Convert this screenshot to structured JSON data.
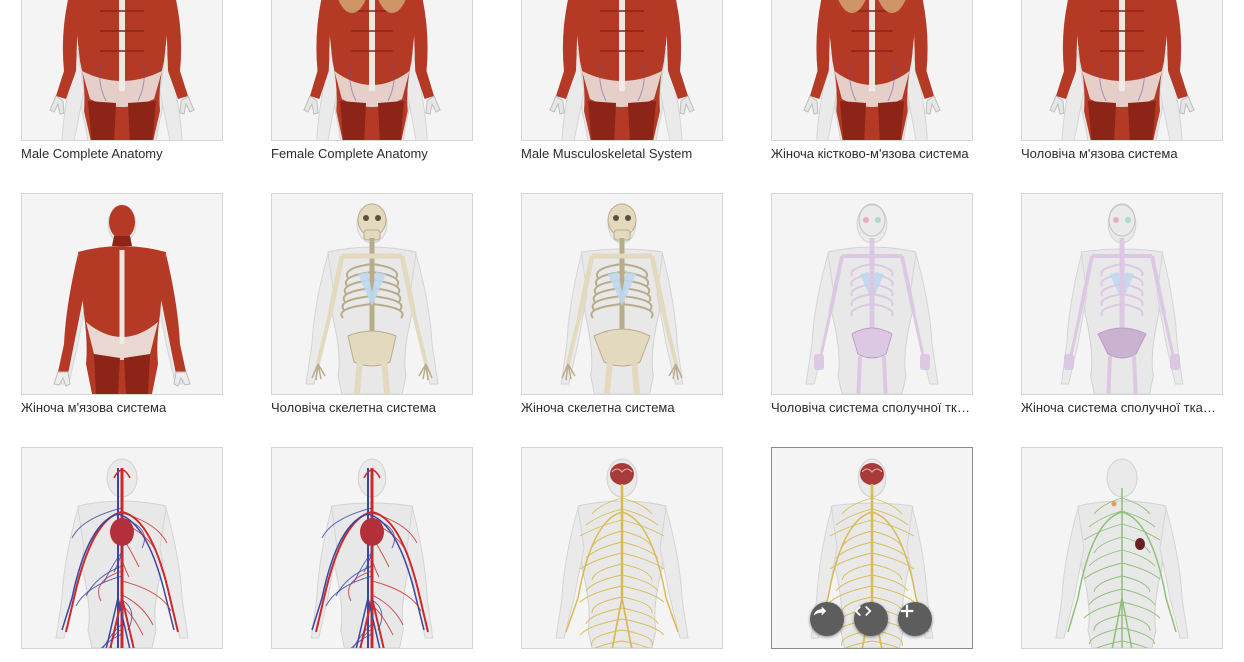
{
  "gallery": {
    "items": [
      {
        "name": "model-male-complete-anatomy",
        "title": "Male Complete Anatomy",
        "sex": "male",
        "system": "muscle",
        "view": "torso"
      },
      {
        "name": "model-female-complete-anatomy",
        "title": "Female Complete Anatomy",
        "sex": "female",
        "system": "muscle",
        "view": "torso"
      },
      {
        "name": "model-male-musculoskeletal",
        "title": "Male Musculoskeletal System",
        "sex": "male",
        "system": "muscle",
        "view": "torso"
      },
      {
        "name": "model-female-musculoskeletal",
        "title": "Жіноча кістково-м'язова система",
        "sex": "female",
        "system": "muscle",
        "view": "torso"
      },
      {
        "name": "model-male-muscular",
        "title": "Чоловіча м'язова система",
        "sex": "male",
        "system": "muscle",
        "view": "torso"
      },
      {
        "name": "model-female-muscular",
        "title": "Жіноча м'язова система",
        "sex": "female",
        "system": "muscle",
        "view": "full"
      },
      {
        "name": "model-male-skeletal",
        "title": "Чоловіча скелетна система",
        "sex": "male",
        "system": "skeleton",
        "view": "full"
      },
      {
        "name": "model-female-skeletal",
        "title": "Жіноча скелетна система",
        "sex": "female",
        "system": "skeleton",
        "view": "full"
      },
      {
        "name": "model-male-connective",
        "title": "Чоловіча система сполучної тканини",
        "sex": "male",
        "system": "connective",
        "view": "full"
      },
      {
        "name": "model-female-connective",
        "title": "Жіноча система сполучної тканини",
        "sex": "female",
        "system": "connective",
        "view": "full"
      },
      {
        "name": "model-male-cardiovascular",
        "title": "",
        "sex": "male",
        "system": "vascular",
        "view": "full"
      },
      {
        "name": "model-female-cardiovascular",
        "title": "",
        "sex": "female",
        "system": "vascular",
        "view": "full"
      },
      {
        "name": "model-male-nervous",
        "title": "",
        "sex": "male",
        "system": "nervous",
        "view": "full"
      },
      {
        "name": "model-female-nervous",
        "title": "",
        "sex": "female",
        "system": "nervous",
        "view": "full",
        "hovered": true
      },
      {
        "name": "model-lymphatic",
        "title": "",
        "sex": "male",
        "system": "lymphatic",
        "view": "full"
      }
    ]
  },
  "hover_actions": [
    {
      "name": "share-button",
      "icon": "share-icon"
    },
    {
      "name": "embed-button",
      "icon": "code-icon"
    },
    {
      "name": "add-button",
      "icon": "plus-icon"
    }
  ],
  "colors": {
    "thumb_bg": "#f4f4f4",
    "muscle": "#b53a26",
    "muscle_dark": "#8c2417",
    "bone": "#e3d9bf",
    "cartilage": "#bcd8ee",
    "connective": "#dcc7e3",
    "artery": "#cc2a2a",
    "vein": "#3747a4",
    "nerve": "#d9bb55",
    "brain": "#a83a3a",
    "lymph": "#8fbf7a",
    "action_button": "#5d5d5d"
  }
}
